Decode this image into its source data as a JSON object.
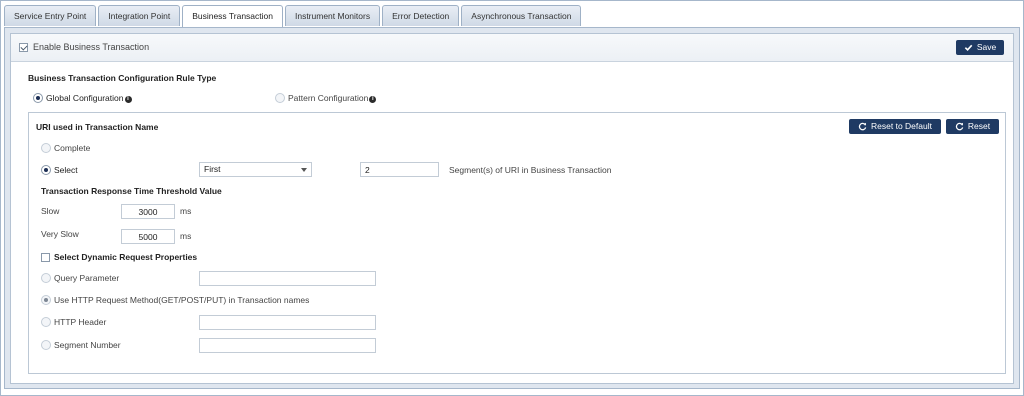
{
  "tabs": [
    {
      "label": "Service Entry Point",
      "active": false
    },
    {
      "label": "Integration Point",
      "active": false
    },
    {
      "label": "Business Transaction",
      "active": true
    },
    {
      "label": "Instrument Monitors",
      "active": false
    },
    {
      "label": "Error Detection",
      "active": false
    },
    {
      "label": "Asynchronous Transaction",
      "active": false
    }
  ],
  "header": {
    "enable_label": "Enable Business Transaction",
    "enable_checked": true,
    "save_label": "Save"
  },
  "config_rule": {
    "title": "Business Transaction Configuration Rule Type",
    "global_label": "Global Configuration",
    "pattern_label": "Pattern Configuration",
    "selected": "global"
  },
  "uri_section": {
    "title": "URI used in Transaction Name",
    "reset_default_label": "Reset to Default",
    "reset_label": "Reset",
    "complete_label": "Complete",
    "select_label": "Select",
    "selected": "select",
    "dropdown_value": "First",
    "segment_value": "2",
    "segment_suffix": "Segment(s) of URI in Business Transaction"
  },
  "threshold": {
    "title": "Transaction Response Time Threshold Value",
    "slow_label": "Slow",
    "slow_value": "3000",
    "slow_unit": "ms",
    "very_slow_label": "Very Slow",
    "very_slow_value": "5000",
    "very_slow_unit": "ms"
  },
  "dynamic": {
    "title": "Select Dynamic Request Properties",
    "checked": false,
    "query_param_label": "Query Parameter",
    "query_param_value": "",
    "http_method_label": "Use HTTP Request Method(GET/POST/PUT) in Transaction names",
    "http_header_label": "HTTP Header",
    "http_header_value": "",
    "segment_number_label": "Segment Number",
    "segment_number_value": ""
  },
  "colors": {
    "primary_button": "#1f3a63",
    "tab_border": "#9fb1c6",
    "page_bg": "#c9d6e6"
  },
  "icons": {
    "save": "checkmark-icon",
    "reset": "refresh-icon",
    "info": "info-icon"
  }
}
